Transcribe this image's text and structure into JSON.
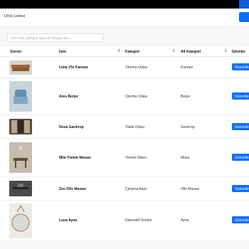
{
  "header": {
    "title": "Ürün Listesi"
  },
  "search": {
    "placeholder": "Ürün ismi, kategori veya alt kategori ara..."
  },
  "columns": [
    "Görsel",
    "İsim",
    "Kategori",
    "Alt Kategori",
    "İşlemler"
  ],
  "rows": [
    {
      "name": "Lima 3'lü Kanepe",
      "category": "Oturma Odası",
      "subcategory": "Kanepe",
      "action": "Güncelle",
      "thumb": "sofa"
    },
    {
      "name": "Ares Berjer",
      "category": "Oturma Odası",
      "subcategory": "Berjer",
      "action": "Güncelle",
      "thumb": "armchair"
    },
    {
      "name": "Nova Gardırop",
      "category": "Yatak Odası",
      "subcategory": "Gardırop",
      "action": "Güncelle",
      "thumb": "wardrobe"
    },
    {
      "name": "Mila Yemek Masası",
      "category": "Yemek Odası",
      "subcategory": "Masa",
      "action": "Güncelle",
      "thumb": "dining-table"
    },
    {
      "name": "Zen Ofis Masası",
      "category": "Çalışma Alanı",
      "subcategory": "Ofis Masası",
      "action": "Güncelle",
      "thumb": "office-desk"
    },
    {
      "name": "Luna Ayna",
      "category": "Dekoratif Ürünler",
      "subcategory": "Ayna",
      "action": "Güncelle",
      "thumb": "mirror"
    }
  ],
  "colors": {
    "primary": "#0d6efd",
    "topbar": "#000000"
  }
}
